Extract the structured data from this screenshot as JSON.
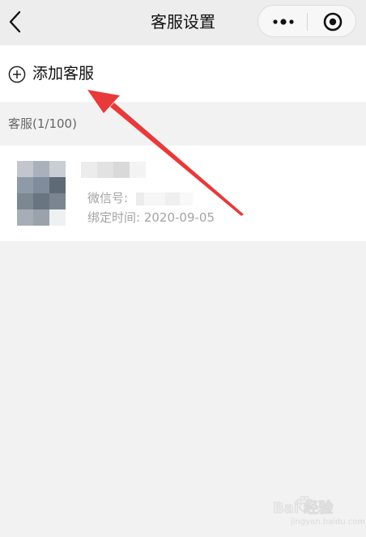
{
  "nav": {
    "title": "客服设置",
    "back_icon": "chevron-left-icon",
    "more_icon": "more-dots-icon",
    "close_icon": "target-icon"
  },
  "add_service": {
    "icon": "plus-circle-icon",
    "label": "添加客服"
  },
  "section": {
    "header": "客服(1/100)"
  },
  "service_list": [
    {
      "avatar": "blurred-avatar",
      "name": "",
      "wechat_label": "微信号:",
      "wechat_id": "",
      "bind_time_label": "绑定时间:",
      "bind_time": "2020-09-05"
    }
  ],
  "annotation": {
    "arrow_color": "#e83a3a"
  },
  "watermark": {
    "brand": "Bai  经验",
    "url": "jingyan.baidu.com"
  }
}
